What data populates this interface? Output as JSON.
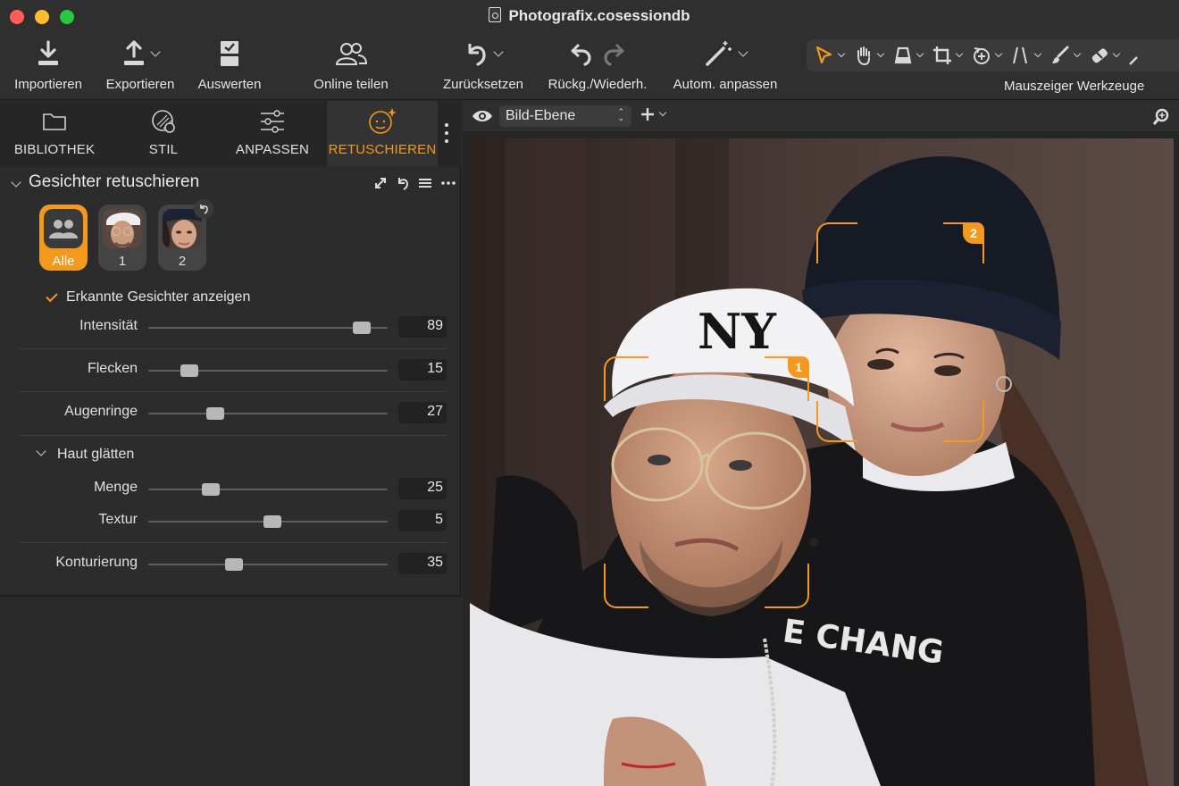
{
  "window": {
    "title": "Photografix.cosessiondb"
  },
  "toolbar": {
    "importieren": "Importieren",
    "exportieren": "Exportieren",
    "auswerten": "Auswerten",
    "online_teilen": "Online teilen",
    "zuruecksetzen": "Zurücksetzen",
    "rueckg_wiederh": "Rückg./Wiederh.",
    "autom_anpassen": "Autom. anpassen",
    "mauszeiger_werkzeuge": "Mauszeiger Werkzeuge",
    "tools": [
      "select-arrow-icon",
      "hand-pan-icon",
      "keystone-icon",
      "crop-icon",
      "rotate-icon",
      "straighten-icon",
      "brush-icon",
      "eraser-icon"
    ]
  },
  "tabs": [
    {
      "label": "BIBLIOTHEK",
      "icon": "folder-icon"
    },
    {
      "label": "STIL",
      "icon": "style-icon"
    },
    {
      "label": "ANPASSEN",
      "icon": "sliders-icon"
    },
    {
      "label": "RETUSCHIEREN",
      "icon": "face-retouch-icon",
      "active": true
    }
  ],
  "retouch": {
    "section_title": "Gesichter retuschieren",
    "faces": [
      {
        "label": "Alle"
      },
      {
        "label": "1"
      },
      {
        "label": "2"
      }
    ],
    "show_faces_label": "Erkannte Gesichter anzeigen",
    "show_faces_checked": true,
    "sliders": {
      "intensitaet": {
        "label": "Intensität",
        "value": "89",
        "position": 0.89
      },
      "flecken": {
        "label": "Flecken",
        "value": "15",
        "position": 0.17
      },
      "augenringe": {
        "label": "Augenringe",
        "value": "27",
        "position": 0.28
      },
      "menge": {
        "label": "Menge",
        "value": "25",
        "position": 0.26
      },
      "textur": {
        "label": "Textur",
        "value": "5",
        "position": 0.52
      },
      "konturierung": {
        "label": "Konturierung",
        "value": "35",
        "position": 0.36
      }
    },
    "skin_section_title": "Haut glätten"
  },
  "viewer": {
    "layer_name": "Bild-Ebene",
    "face_markers": [
      "1",
      "2"
    ]
  },
  "colors": {
    "accent": "#f39a1e"
  }
}
